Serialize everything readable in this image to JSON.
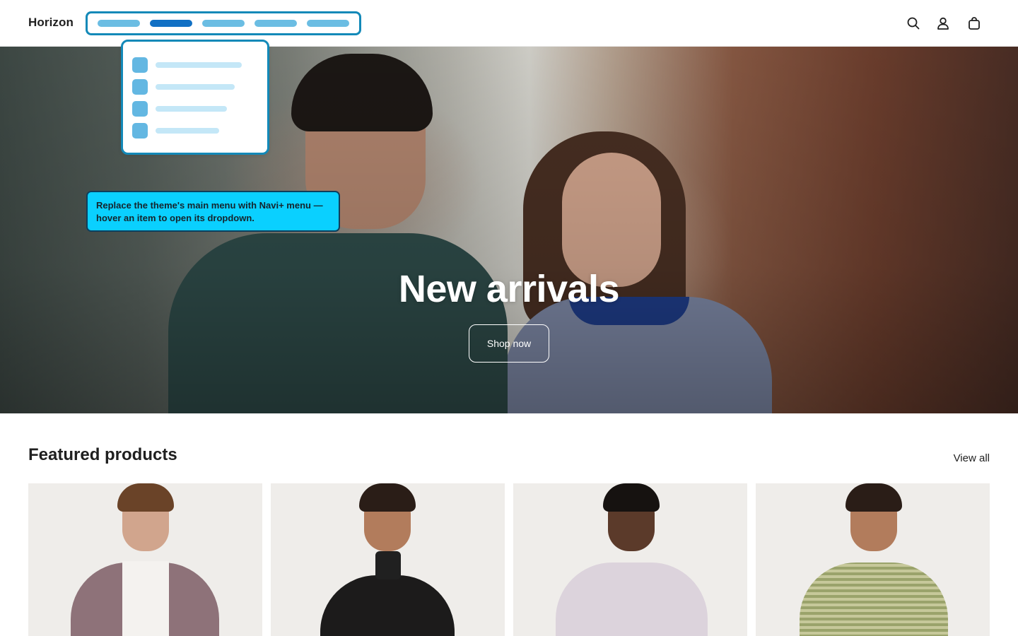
{
  "header": {
    "logo": "Horizon",
    "nav_pills": 5,
    "active_pill_index": 1,
    "icons": [
      "search-icon",
      "account-icon",
      "cart-icon"
    ]
  },
  "dropdown": {
    "rows": 4
  },
  "callout": {
    "text": "Replace the theme's main menu with Navi+ menu — hover an item to open its dropdown."
  },
  "hero": {
    "title": "New arrivals",
    "button_label": "Shop now"
  },
  "featured": {
    "title": "Featured products",
    "view_all_label": "View all",
    "products": [
      {
        "garment": "mauve cardigan"
      },
      {
        "garment": "black turtleneck"
      },
      {
        "garment": "lilac sweater"
      },
      {
        "garment": "green striped top"
      }
    ]
  },
  "colors": {
    "accent": "#1389b8",
    "active_pill": "#1170c4",
    "pill": "#6bbde3",
    "callout_bg": "#0ad0ff"
  }
}
